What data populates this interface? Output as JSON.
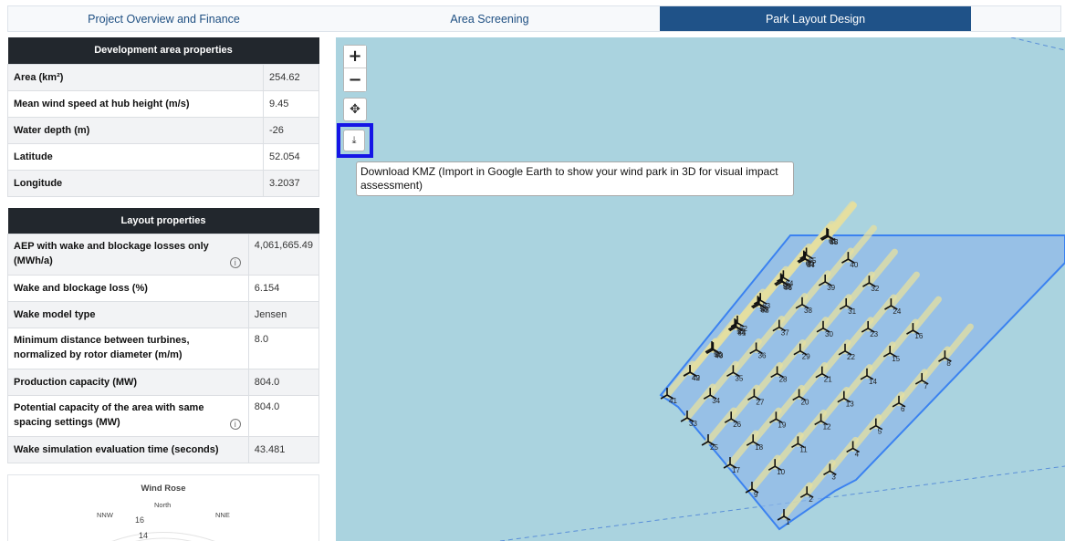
{
  "tabs": [
    {
      "label": "Project Overview and Finance"
    },
    {
      "label": "Area Screening"
    },
    {
      "label": "Park Layout Design"
    }
  ],
  "development_area": {
    "title": "Development area properties",
    "rows": [
      {
        "label": "Area (km²)",
        "value": "254.62"
      },
      {
        "label": "Mean wind speed at hub height (m/s)",
        "value": "9.45"
      },
      {
        "label": "Water depth (m)",
        "value": "-26"
      },
      {
        "label": "Latitude",
        "value": "52.054"
      },
      {
        "label": "Longitude",
        "value": "3.2037"
      }
    ]
  },
  "layout": {
    "title": "Layout properties",
    "rows": [
      {
        "label": "AEP with wake and blockage losses only (MWh/a)",
        "value": "4,061,665.49",
        "info": "i"
      },
      {
        "label": "Wake and blockage loss (%)",
        "value": "6.154"
      },
      {
        "label": "Wake model type",
        "value": "Jensen"
      },
      {
        "label": "Minimum distance between turbines, normalized by rotor diameter (m/m)",
        "value": "8.0"
      },
      {
        "label": "Production capacity (MW)",
        "value": "804.0"
      },
      {
        "label": "Potential capacity of the area with same spacing settings (MW)",
        "value": "804.0",
        "info": "i"
      },
      {
        "label": "Wake simulation evaluation time (seconds)",
        "value": "43.481"
      }
    ]
  },
  "wind_rose": {
    "title": "Wind Rose",
    "directions": {
      "n": "North",
      "nnw": "NNW",
      "nne": "NNE"
    },
    "radial_labels": [
      "16",
      "14"
    ]
  },
  "map": {
    "zoom_in": "+",
    "zoom_out": "−",
    "move_icon": "✥",
    "download_icon": "⤓",
    "tooltip": "Download KMZ (Import in Google Earth to show your wind park in 3D for visual impact assessment)",
    "colors": {
      "water": "#aad3df",
      "area_fill": "#8fb8e8",
      "area_stroke": "#3b82f0",
      "highlight": "#1515e6"
    },
    "turbine_count": "67"
  }
}
